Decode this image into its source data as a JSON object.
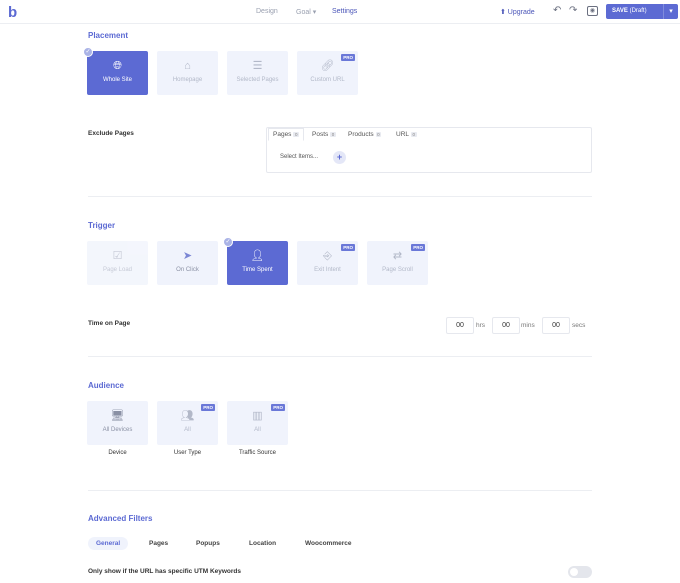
{
  "topbar": {
    "logo": "b",
    "nav": [
      "Design",
      "Goal ▾",
      "Settings"
    ],
    "upgrade": "⬆ Upgrade",
    "save": "SAVE",
    "save_state": "(Draft)"
  },
  "placement": {
    "title": "Placement",
    "cards": [
      {
        "label": "Whole Site",
        "icon": "globe-icon",
        "selected": true
      },
      {
        "label": "Homepage",
        "icon": "home-icon"
      },
      {
        "label": "Selected Pages",
        "icon": "list-icon"
      },
      {
        "label": "Custom URL",
        "icon": "link-icon",
        "pro": "PRO"
      }
    ]
  },
  "exclude": {
    "label": "Exclude Pages",
    "tabs": [
      {
        "label": "Pages",
        "count": "0"
      },
      {
        "label": "Posts",
        "count": "0"
      },
      {
        "label": "Products",
        "count": "0"
      },
      {
        "label": "URL",
        "count": "0"
      }
    ],
    "select_text": "Select Items..."
  },
  "trigger": {
    "title": "Trigger",
    "cards": [
      {
        "label": "Page Load",
        "icon": "checkbox-icon"
      },
      {
        "label": "On Click",
        "icon": "cursor-icon"
      },
      {
        "label": "Time Spent",
        "icon": "user-clock-icon",
        "selected": true
      },
      {
        "label": "Exit Intent",
        "icon": "door-icon",
        "pro": "PRO"
      },
      {
        "label": "Page Scroll",
        "icon": "arrows-icon",
        "pro": "PRO"
      }
    ]
  },
  "time": {
    "label": "Time on Page",
    "hrs": "00",
    "hrs_unit": "hrs",
    "mins": "00",
    "mins_unit": "mins",
    "secs": "00",
    "secs_unit": "secs"
  },
  "audience": {
    "title": "Audience",
    "cards": [
      {
        "label": "All Devices",
        "icon": "monitor-icon",
        "caption": "Device"
      },
      {
        "label": "All",
        "icon": "users-icon",
        "pro": "PRO",
        "caption": "User Type"
      },
      {
        "label": "All",
        "icon": "chart-icon",
        "pro": "PRO",
        "caption": "Traffic Source"
      }
    ]
  },
  "filters": {
    "title": "Advanced Filters",
    "tabs": [
      "General",
      "Pages",
      "Popups",
      "Location",
      "Woocommerce"
    ],
    "utm_label": "Only show if the URL has specific UTM Keywords"
  }
}
